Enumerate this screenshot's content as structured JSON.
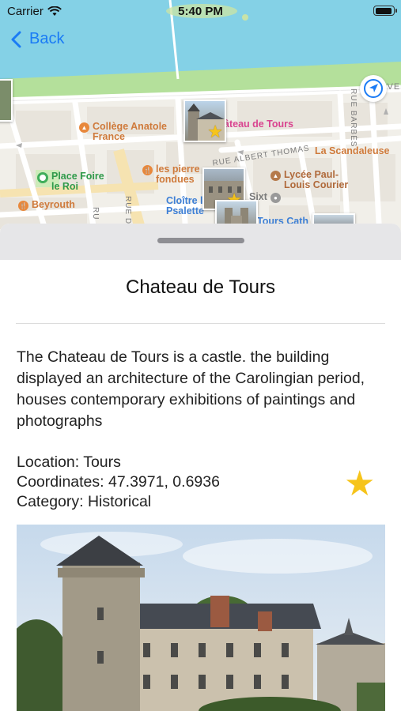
{
  "status_bar": {
    "carrier": "Carrier",
    "time": "5:40 PM",
    "battery_level_percent": 95
  },
  "nav": {
    "back_label": "Back"
  },
  "map": {
    "pois": [
      {
        "label": "Collège Anatole France",
        "color": "#cf7a3b"
      },
      {
        "label": "âteau de Tours",
        "color": "#d9438f"
      },
      {
        "label": "La Scandaleuse",
        "color": "#cf7a3b"
      },
      {
        "label": "Place Foire le Roi",
        "color": "#2f9a4a"
      },
      {
        "label": "les pierre fondues",
        "color": "#cf7a3b"
      },
      {
        "label": "Lycée Paul-Louis Courier",
        "color": "#b06a3b"
      },
      {
        "label": "Beyrouth",
        "color": "#cf7a3b"
      },
      {
        "label": "Cloître la Psalette",
        "color": "#3d7fd6"
      },
      {
        "label": "Sixt",
        "color": "#7c7c7c"
      },
      {
        "label": "Tours Cath",
        "color": "#3d7fd6"
      }
    ],
    "streets": [
      "RUE ALBERT THOMAS",
      "RUE BARBÈS",
      "RUE D",
      "RU",
      "AVEN"
    ],
    "icons": {
      "locate": "location-arrow-icon",
      "back": "chevron-left-icon"
    }
  },
  "detail": {
    "title": "Chateau de Tours",
    "description": "The Chateau de Tours is a castle. the building displayed an architecture of the Carolingian period, houses contemporary exhibitions of paintings and photographs",
    "location_line": "Location: Tours",
    "coordinates_line": "Coordinates: 47.3971, 0.6936",
    "category_line": "Category: Historical",
    "favorite": true,
    "favorite_color": "#f6c41b"
  },
  "colors": {
    "accent": "#1a7bf5",
    "water": "#7fd0e6",
    "park": "#a9dc8e",
    "sheet_header": "#e6e6e8"
  }
}
